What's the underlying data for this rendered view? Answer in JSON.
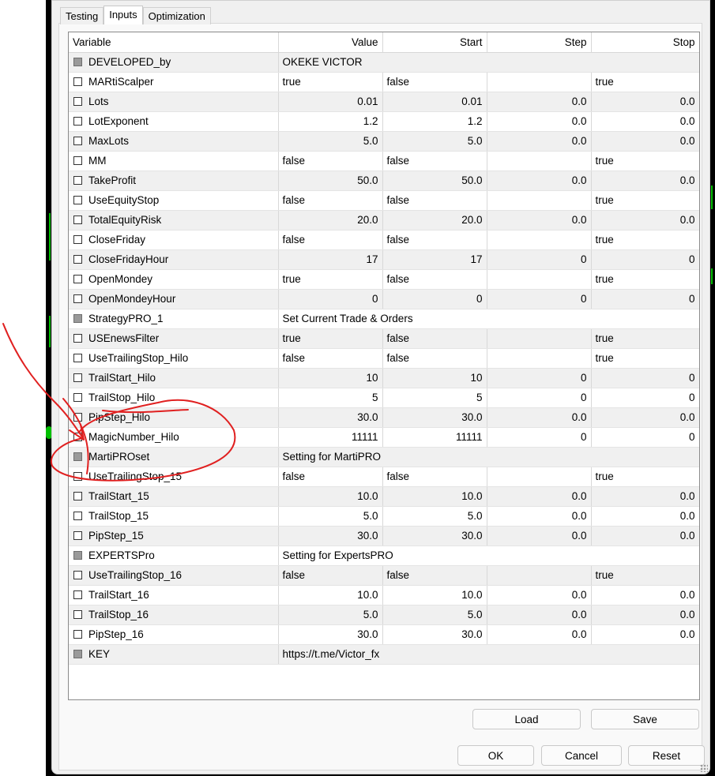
{
  "tabs": [
    "Testing",
    "Inputs",
    "Optimization"
  ],
  "columns": [
    "Variable",
    "Value",
    "Start",
    "Step",
    "Stop"
  ],
  "rows": [
    {
      "checkbox": "disabled",
      "name": "DEVELOPED_by",
      "value": "OKEKE VICTOR",
      "start": "",
      "step": "",
      "stop": "",
      "numeric": false,
      "span": true
    },
    {
      "checkbox": "unchecked",
      "name": "MARtiScalper",
      "value": "true",
      "start": "false",
      "step": "",
      "stop": "true",
      "numeric": false
    },
    {
      "checkbox": "unchecked",
      "name": "Lots",
      "value": "0.01",
      "start": "0.01",
      "step": "0.0",
      "stop": "0.0",
      "numeric": true
    },
    {
      "checkbox": "unchecked",
      "name": "LotExponent",
      "value": "1.2",
      "start": "1.2",
      "step": "0.0",
      "stop": "0.0",
      "numeric": true
    },
    {
      "checkbox": "unchecked",
      "name": "MaxLots",
      "value": "5.0",
      "start": "5.0",
      "step": "0.0",
      "stop": "0.0",
      "numeric": true
    },
    {
      "checkbox": "unchecked",
      "name": "MM",
      "value": "false",
      "start": "false",
      "step": "",
      "stop": "true",
      "numeric": false
    },
    {
      "checkbox": "unchecked",
      "name": "TakeProfit",
      "value": "50.0",
      "start": "50.0",
      "step": "0.0",
      "stop": "0.0",
      "numeric": true
    },
    {
      "checkbox": "unchecked",
      "name": "UseEquityStop",
      "value": "false",
      "start": "false",
      "step": "",
      "stop": "true",
      "numeric": false
    },
    {
      "checkbox": "unchecked",
      "name": "TotalEquityRisk",
      "value": "20.0",
      "start": "20.0",
      "step": "0.0",
      "stop": "0.0",
      "numeric": true
    },
    {
      "checkbox": "unchecked",
      "name": "CloseFriday",
      "value": "false",
      "start": "false",
      "step": "",
      "stop": "true",
      "numeric": false
    },
    {
      "checkbox": "unchecked",
      "name": "CloseFridayHour",
      "value": "17",
      "start": "17",
      "step": "0",
      "stop": "0",
      "numeric": true
    },
    {
      "checkbox": "unchecked",
      "name": "OpenMondey",
      "value": "true",
      "start": "false",
      "step": "",
      "stop": "true",
      "numeric": false
    },
    {
      "checkbox": "unchecked",
      "name": "OpenMondeyHour",
      "value": "0",
      "start": "0",
      "step": "0",
      "stop": "0",
      "numeric": true
    },
    {
      "checkbox": "disabled",
      "name": "StrategyPRO_1",
      "value": "Set Current Trade & Orders",
      "start": "",
      "step": "",
      "stop": "",
      "numeric": false,
      "span": true
    },
    {
      "checkbox": "unchecked",
      "name": "USEnewsFilter",
      "value": "true",
      "start": "false",
      "step": "",
      "stop": "true",
      "numeric": false
    },
    {
      "checkbox": "unchecked",
      "name": "UseTrailingStop_Hilo",
      "value": "false",
      "start": "false",
      "step": "",
      "stop": "true",
      "numeric": false
    },
    {
      "checkbox": "unchecked",
      "name": "TrailStart_Hilo",
      "value": "10",
      "start": "10",
      "step": "0",
      "stop": "0",
      "numeric": true
    },
    {
      "checkbox": "unchecked",
      "name": "TrailStop_Hilo",
      "value": "5",
      "start": "5",
      "step": "0",
      "stop": "0",
      "numeric": true
    },
    {
      "checkbox": "unchecked",
      "name": "PipStep_Hilo",
      "value": "30.0",
      "start": "30.0",
      "step": "0.0",
      "stop": "0.0",
      "numeric": true
    },
    {
      "checkbox": "unchecked",
      "name": "MagicNumber_Hilo",
      "value": "11111",
      "start": "11111",
      "step": "0",
      "stop": "0",
      "numeric": true
    },
    {
      "checkbox": "disabled",
      "name": "MartiPROset",
      "value": "Setting for MartiPRO",
      "start": "",
      "step": "",
      "stop": "",
      "numeric": false,
      "span": true
    },
    {
      "checkbox": "unchecked",
      "name": "UseTrailingStop_15",
      "value": "false",
      "start": "false",
      "step": "",
      "stop": "true",
      "numeric": false
    },
    {
      "checkbox": "unchecked",
      "name": "TrailStart_15",
      "value": "10.0",
      "start": "10.0",
      "step": "0.0",
      "stop": "0.0",
      "numeric": true
    },
    {
      "checkbox": "unchecked",
      "name": "TrailStop_15",
      "value": "5.0",
      "start": "5.0",
      "step": "0.0",
      "stop": "0.0",
      "numeric": true
    },
    {
      "checkbox": "unchecked",
      "name": "PipStep_15",
      "value": "30.0",
      "start": "30.0",
      "step": "0.0",
      "stop": "0.0",
      "numeric": true
    },
    {
      "checkbox": "disabled",
      "name": "EXPERTSPro",
      "value": "Setting for ExpertsPRO",
      "start": "",
      "step": "",
      "stop": "",
      "numeric": false,
      "span": true
    },
    {
      "checkbox": "unchecked",
      "name": "UseTrailingStop_16",
      "value": "false",
      "start": "false",
      "step": "",
      "stop": "true",
      "numeric": false
    },
    {
      "checkbox": "unchecked",
      "name": "TrailStart_16",
      "value": "10.0",
      "start": "10.0",
      "step": "0.0",
      "stop": "0.0",
      "numeric": true
    },
    {
      "checkbox": "unchecked",
      "name": "TrailStop_16",
      "value": "5.0",
      "start": "5.0",
      "step": "0.0",
      "stop": "0.0",
      "numeric": true
    },
    {
      "checkbox": "unchecked",
      "name": "PipStep_16",
      "value": "30.0",
      "start": "30.0",
      "step": "0.0",
      "stop": "0.0",
      "numeric": true
    },
    {
      "checkbox": "disabled",
      "name": "KEY",
      "value": "https://t.me/Victor_fx",
      "start": "",
      "step": "",
      "stop": "",
      "numeric": false,
      "span": true
    }
  ],
  "buttons": {
    "load": "Load",
    "save": "Save",
    "ok": "OK",
    "cancel": "Cancel",
    "reset": "Reset"
  },
  "annotation": {
    "color": "#e02020"
  }
}
